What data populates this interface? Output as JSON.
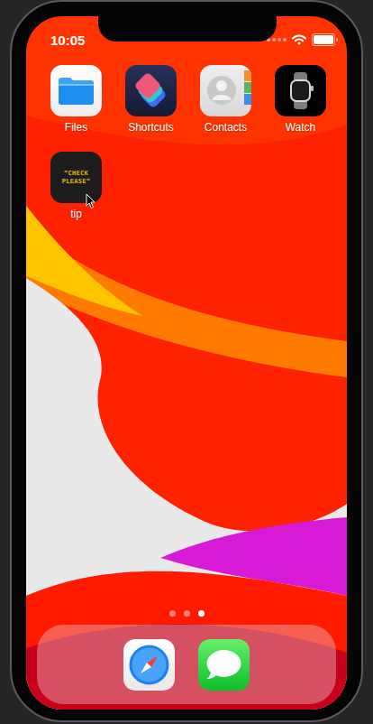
{
  "status_bar": {
    "time": "10:05",
    "battery": {
      "level": 1.0
    }
  },
  "apps": [
    {
      "label": "Files",
      "kind": "files"
    },
    {
      "label": "Shortcuts",
      "kind": "shortcuts"
    },
    {
      "label": "Contacts",
      "kind": "contacts"
    },
    {
      "label": "Watch",
      "kind": "watch"
    },
    {
      "label": "tip",
      "kind": "tip",
      "logo_lines": [
        "“CHECK",
        "PLEASE”"
      ]
    }
  ],
  "page_dots": [
    {
      "selected": false
    },
    {
      "selected": false
    },
    {
      "selected": true
    }
  ],
  "dock": [
    {
      "kind": "safari"
    },
    {
      "kind": "messages"
    }
  ]
}
